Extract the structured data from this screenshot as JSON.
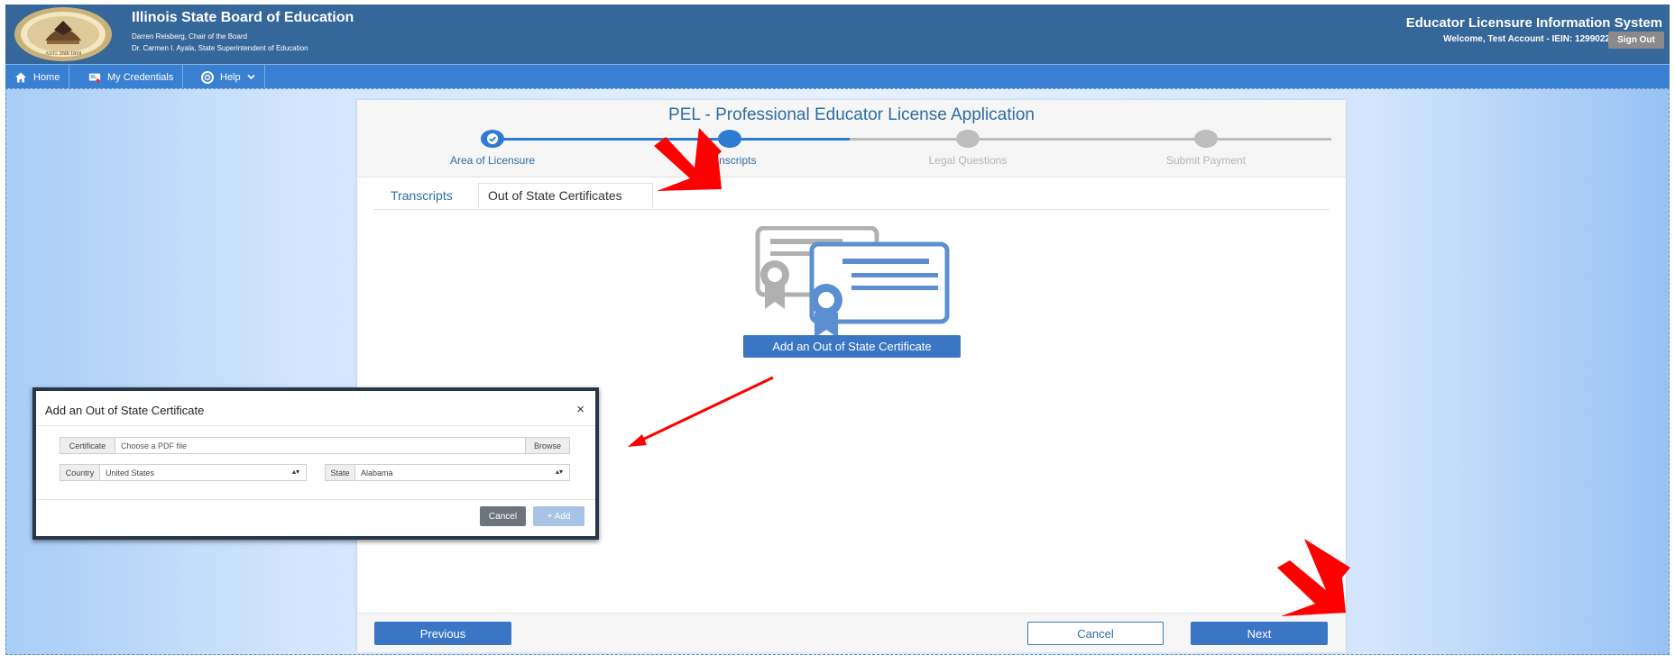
{
  "header": {
    "org_title": "Illinois State Board of Education",
    "chair": "Darren Reisberg, Chair of the Board",
    "superintendent": "Dr. Carmen I. Ayala, State Superintendent of Education",
    "system_title": "Educator Licensure Information System",
    "welcome": "Welcome, Test Account - IEIN: 1299022",
    "sign_out_label": "Sign Out"
  },
  "nav": {
    "items": [
      {
        "label": "Home",
        "icon": "home-icon"
      },
      {
        "label": "My Credentials",
        "icon": "credentials-icon"
      },
      {
        "label": "Help",
        "icon": "help-icon"
      }
    ]
  },
  "card": {
    "title": "PEL - Professional Educator License Application",
    "steps": [
      {
        "label": "Area of Licensure",
        "state": "complete"
      },
      {
        "label": "Transcripts",
        "state": "current"
      },
      {
        "label": "Legal Questions",
        "state": "upcoming"
      },
      {
        "label": "Submit Payment",
        "state": "upcoming"
      }
    ],
    "tabs": [
      {
        "label": "Transcripts",
        "active": false
      },
      {
        "label": "Out of State Certificates",
        "active": true
      }
    ],
    "add_cert_label": "Add an Out of State Certificate",
    "footer": {
      "previous_label": "Previous",
      "cancel_label": "Cancel",
      "next_label": "Next"
    }
  },
  "modal": {
    "title": "Add an Out of State Certificate",
    "close_glyph": "×",
    "certificate_label": "Certificate",
    "certificate_placeholder": "Choose a PDF file",
    "browse_label": "Browse",
    "country_label": "Country",
    "country_value": "United States",
    "state_label": "State",
    "state_value": "Alabama",
    "cancel_label": "Cancel",
    "add_label": "+ Add"
  },
  "colors": {
    "header_bg": "#36679a",
    "nav_bg": "#3a80d2",
    "primary_button": "#3a76c4",
    "step_complete": "#2e7bd3",
    "step_upcoming": "#bdbdbd",
    "annotation_arrow": "#ff0000"
  }
}
